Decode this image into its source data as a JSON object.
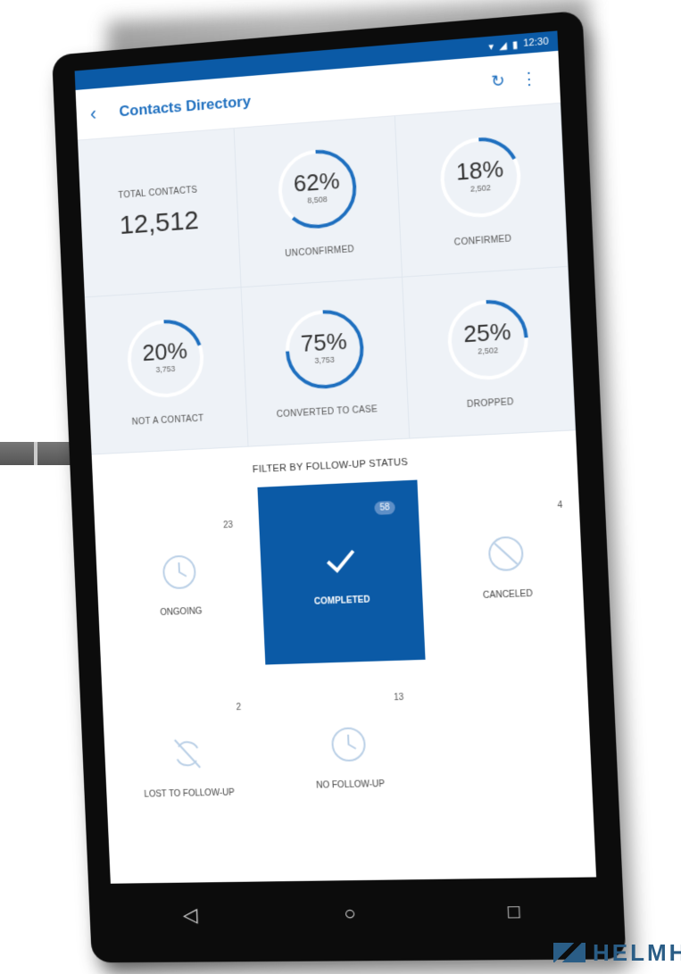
{
  "status_bar": {
    "time": "12:30"
  },
  "header": {
    "title": "Contacts Directory",
    "back_icon": "chevron-left-icon",
    "sync_icon": "sync-icon",
    "menu_icon": "more-vert-icon"
  },
  "total": {
    "label": "TOTAL CONTACTS",
    "value": "12,512"
  },
  "stats": [
    {
      "percent": "62%",
      "count": "8,508",
      "label": "UNCONFIRMED",
      "fraction": 0.62
    },
    {
      "percent": "18%",
      "count": "2,502",
      "label": "CONFIRMED",
      "fraction": 0.18
    },
    {
      "percent": "20%",
      "count": "3,753",
      "label": "NOT A CONTACT",
      "fraction": 0.2
    },
    {
      "percent": "75%",
      "count": "3,753",
      "label": "CONVERTED TO CASE",
      "fraction": 0.75
    },
    {
      "percent": "25%",
      "count": "2,502",
      "label": "DROPPED",
      "fraction": 0.25
    }
  ],
  "filter": {
    "title": "FILTER BY FOLLOW-UP STATUS",
    "items": [
      {
        "label": "ONGOING",
        "count": "23",
        "icon": "clock-icon"
      },
      {
        "label": "COMPLETED",
        "count": "58",
        "icon": "checkmark-icon",
        "selected": true
      },
      {
        "label": "CANCELED",
        "count": "4",
        "icon": "cancel-icon"
      },
      {
        "label": "LOST TO FOLLOW-UP",
        "count": "2",
        "icon": "sync-off-icon"
      },
      {
        "label": "NO FOLLOW-UP",
        "count": "13",
        "icon": "clock-icon"
      }
    ]
  },
  "brand": {
    "text": "HELMH"
  },
  "colors": {
    "primary": "#0b5aa6",
    "ring": "#1e6fbf",
    "ring_track": "#ffffff",
    "icon_muted": "#b9cfe6"
  }
}
